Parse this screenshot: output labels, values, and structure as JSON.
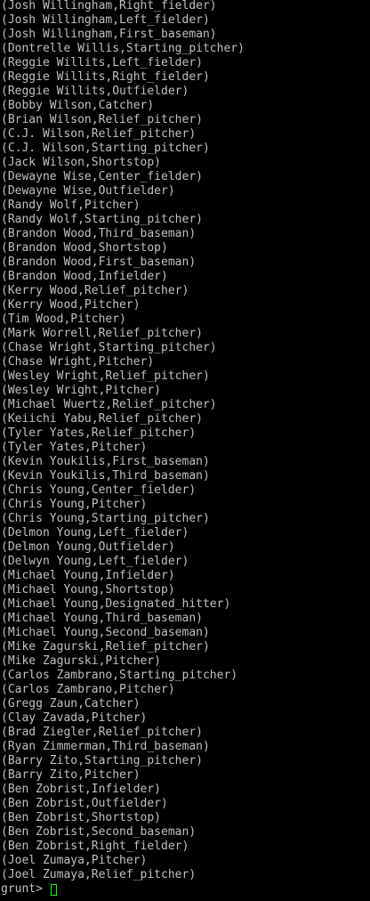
{
  "terminal": {
    "lines": [
      "(Josh Willingham,Right_fielder)",
      "(Josh Willingham,Left_fielder)",
      "(Josh Willingham,First_baseman)",
      "(Dontrelle Willis,Starting_pitcher)",
      "(Reggie Willits,Left_fielder)",
      "(Reggie Willits,Right_fielder)",
      "(Reggie Willits,Outfielder)",
      "(Bobby Wilson,Catcher)",
      "(Brian Wilson,Relief_pitcher)",
      "(C.J. Wilson,Relief_pitcher)",
      "(C.J. Wilson,Starting_pitcher)",
      "(Jack Wilson,Shortstop)",
      "(Dewayne Wise,Center_fielder)",
      "(Dewayne Wise,Outfielder)",
      "(Randy Wolf,Pitcher)",
      "(Randy Wolf,Starting_pitcher)",
      "(Brandon Wood,Third_baseman)",
      "(Brandon Wood,Shortstop)",
      "(Brandon Wood,First_baseman)",
      "(Brandon Wood,Infielder)",
      "(Kerry Wood,Relief_pitcher)",
      "(Kerry Wood,Pitcher)",
      "(Tim Wood,Pitcher)",
      "(Mark Worrell,Relief_pitcher)",
      "(Chase Wright,Starting_pitcher)",
      "(Chase Wright,Pitcher)",
      "(Wesley Wright,Relief_pitcher)",
      "(Wesley Wright,Pitcher)",
      "(Michael Wuertz,Relief_pitcher)",
      "(Keiichi Yabu,Relief_pitcher)",
      "(Tyler Yates,Relief_pitcher)",
      "(Tyler Yates,Pitcher)",
      "(Kevin Youkilis,First_baseman)",
      "(Kevin Youkilis,Third_baseman)",
      "(Chris Young,Center_fielder)",
      "(Chris Young,Pitcher)",
      "(Chris Young,Starting_pitcher)",
      "(Delmon Young,Left_fielder)",
      "(Delmon Young,Outfielder)",
      "(Delwyn Young,Left_fielder)",
      "(Michael Young,Infielder)",
      "(Michael Young,Shortstop)",
      "(Michael Young,Designated_hitter)",
      "(Michael Young,Third_baseman)",
      "(Michael Young,Second_baseman)",
      "(Mike Zagurski,Relief_pitcher)",
      "(Mike Zagurski,Pitcher)",
      "(Carlos Zambrano,Starting_pitcher)",
      "(Carlos Zambrano,Pitcher)",
      "(Gregg Zaun,Catcher)",
      "(Clay Zavada,Pitcher)",
      "(Brad Ziegler,Relief_pitcher)",
      "(Ryan Zimmerman,Third_baseman)",
      "(Barry Zito,Starting_pitcher)",
      "(Barry Zito,Pitcher)",
      "(Ben Zobrist,Infielder)",
      "(Ben Zobrist,Outfielder)",
      "(Ben Zobrist,Shortstop)",
      "(Ben Zobrist,Second_baseman)",
      "(Ben Zobrist,Right_fielder)",
      "(Joel Zumaya,Pitcher)",
      "(Joel Zumaya,Relief_pitcher)"
    ],
    "prompt": "grunt> ",
    "colors": {
      "background": "#000000",
      "text": "#c0c0c0",
      "cursor": "#00ff00"
    }
  }
}
